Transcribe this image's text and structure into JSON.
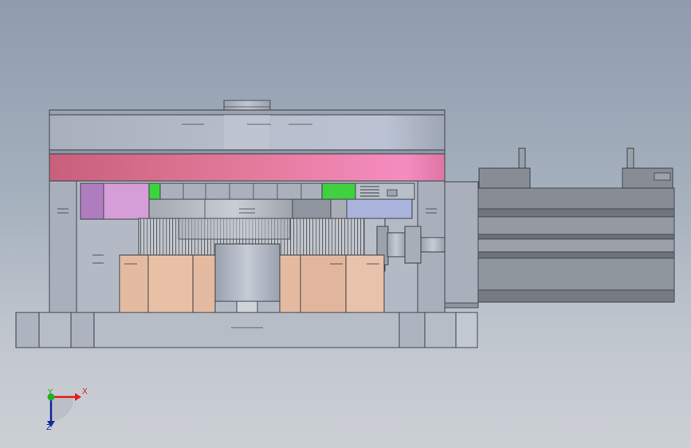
{
  "viewport": {
    "background_top": "#8e9cad",
    "background_bottom": "#ccd0d5"
  },
  "model": {
    "colors": {
      "steel_gray": "#b4bbc6",
      "table_top": "#aeb6c4",
      "pink_ring": "#e87aa0",
      "magenta_block": "#c07ac8",
      "green_part": "#3cd43c",
      "gear_blue": "#a8b4d8",
      "bearing_peach": "#e6bca0",
      "motor_dark": "#7a7f87",
      "base_gray": "#b6bcc6"
    }
  },
  "triad": {
    "x_label": "X",
    "y_label": "Y",
    "z_label": "Z",
    "x_color": "#e0201a",
    "y_color": "#20a020",
    "z_color": "#1a2a9a",
    "icon": "coordinate-triad-icon"
  }
}
